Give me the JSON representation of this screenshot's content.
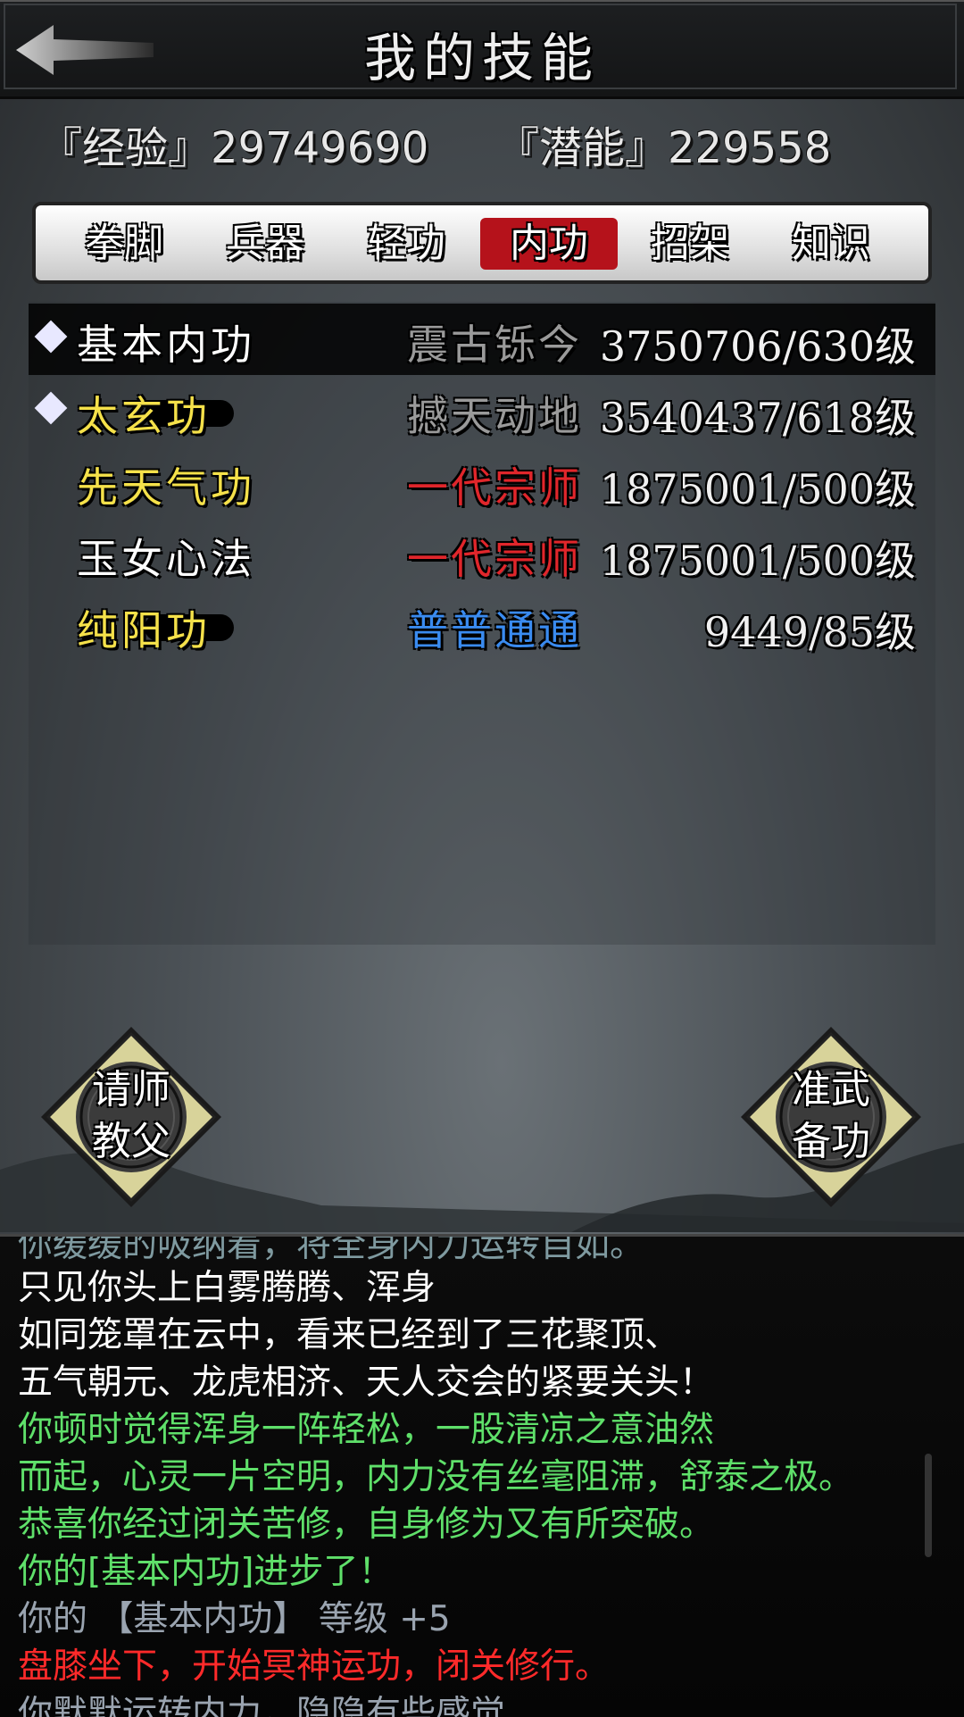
{
  "header": {
    "title": "我的技能"
  },
  "stats": {
    "exp": "『经验』29749690",
    "potential": "『潜能』229558"
  },
  "tabs": [
    {
      "label": "拳脚",
      "active": false
    },
    {
      "label": "兵器",
      "active": false
    },
    {
      "label": "轻功",
      "active": false
    },
    {
      "label": "内功",
      "active": true
    },
    {
      "label": "招架",
      "active": false
    },
    {
      "label": "知识",
      "active": false
    }
  ],
  "skills": [
    {
      "name": "基本内功",
      "rank": "震古铄今",
      "level": "3750706/630级",
      "selected": true,
      "marked": true,
      "name_color": "#ffffff",
      "rank_color": "#9a9a9a"
    },
    {
      "name": "太玄功",
      "rank": "撼天动地",
      "level": "3540437/618级",
      "selected": false,
      "marked": true,
      "name_color": "#f5e14a",
      "rank_color": "#9a9a9a"
    },
    {
      "name": "先天气功",
      "rank": "一代宗师",
      "level": "1875001/500级",
      "selected": false,
      "marked": false,
      "name_color": "#f5e14a",
      "rank_color": "#e0262b"
    },
    {
      "name": "玉女心法",
      "rank": "一代宗师",
      "level": "1875001/500级",
      "selected": false,
      "marked": false,
      "name_color": "#ffffff",
      "rank_color": "#e0262b"
    },
    {
      "name": "纯阳功",
      "rank": "普普通通",
      "level": "9449/85级",
      "selected": false,
      "marked": false,
      "name_color": "#f5e14a",
      "rank_color": "#3a8bf0"
    }
  ],
  "buttons": {
    "teacher": {
      "line1": "请师",
      "line2": "教父"
    },
    "prepare": {
      "line1": "准武",
      "line2": "备功"
    }
  },
  "log": [
    {
      "text": "你缓缓的吸纳着，将全身内力运转自如。",
      "color": "#8aa"
    },
    {
      "text": "只见你头上白雾腾腾、浑身",
      "color": "#ffffff"
    },
    {
      "text": "如同笼罩在云中，看来已经到了三花聚顶、",
      "color": "#ffffff"
    },
    {
      "text": "五气朝元、龙虎相济、天人交会的紧要关头！",
      "color": "#ffffff"
    },
    {
      "text": "你顿时觉得浑身一阵轻松，一股清凉之意油然",
      "color": "#5fe06a"
    },
    {
      "text": "而起，心灵一片空明，内力没有丝毫阻滞，舒泰之极。",
      "color": "#5fe06a"
    },
    {
      "text": "恭喜你经过闭关苦修，自身修为又有所突破。",
      "color": "#5fe06a"
    },
    {
      "text": "你的[基本内功]进步了！",
      "color": "#5fe06a"
    },
    {
      "text": "你的 【基本内功】 等级 +5",
      "color": "#9aa4b0"
    },
    {
      "text": "盘膝坐下，开始冥神运功，闭关修行。",
      "color": "#ff2a2a"
    },
    {
      "text": "你默默运转内力，隐隐有些感觉",
      "color": "#9aa4b0"
    }
  ],
  "colors": {
    "tab_active": "#b5121b",
    "rank_red": "#e0262b",
    "rank_blue": "#3a8bf0",
    "name_yellow": "#f5e14a",
    "log_green": "#5fe06a"
  }
}
